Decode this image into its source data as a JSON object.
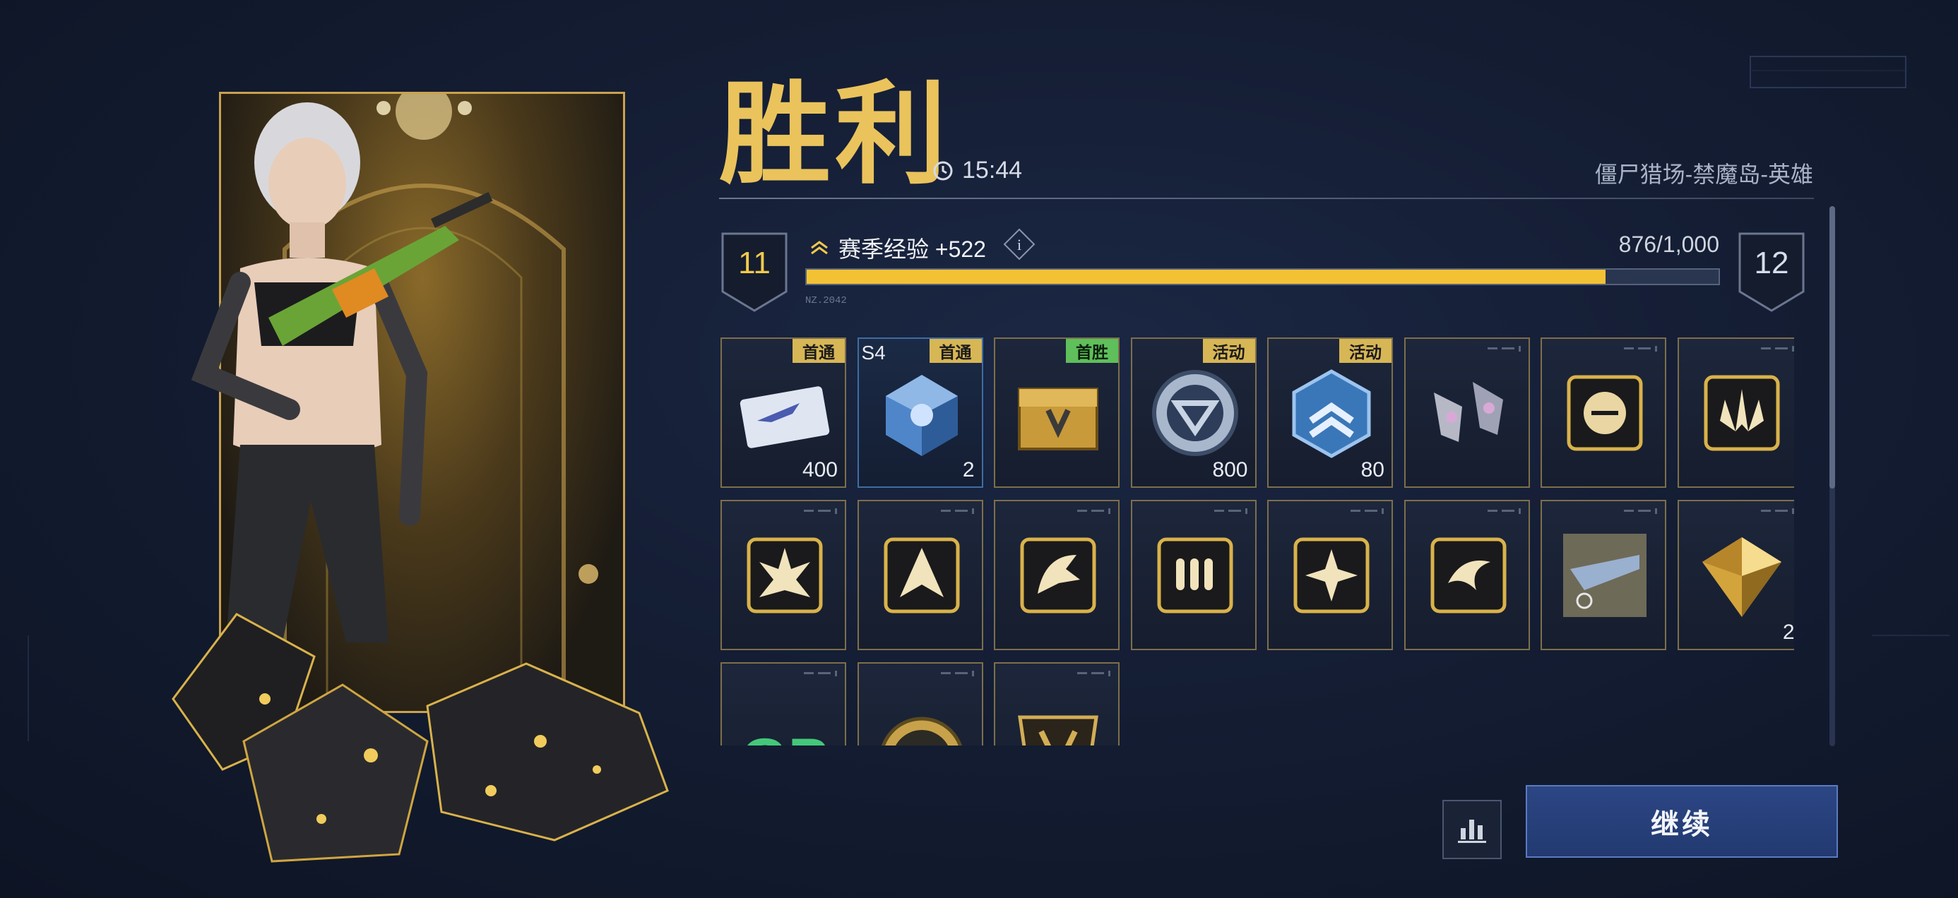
{
  "result": {
    "title": "胜利",
    "time": "15:44",
    "mode": "僵尸猎场-禁魔岛-英雄"
  },
  "xp": {
    "label": "赛季经验 +522",
    "current_level": "11",
    "next_level": "12",
    "progress_text": "876/1,000",
    "progress_fraction": 0.876,
    "bar_tag": "NZ.2042"
  },
  "rewards": [
    {
      "name": "ticket-card-icon",
      "tag": "首通",
      "tag_color": "gold",
      "quantity": "400",
      "style": "gold"
    },
    {
      "name": "s4-crystal-cube-icon",
      "tag": "首通",
      "tag_color": "gold",
      "quantity": "2",
      "season": "S4",
      "style": "blue"
    },
    {
      "name": "golden-chest-icon",
      "tag": "首胜",
      "tag_color": "green",
      "quantity": "",
      "style": "gold"
    },
    {
      "name": "silver-coin-icon",
      "tag": "活动",
      "tag_color": "gold",
      "quantity": "800",
      "style": "gold"
    },
    {
      "name": "rank-badge-icon",
      "tag": "活动",
      "tag_color": "gold",
      "quantity": "80",
      "style": "gold"
    },
    {
      "name": "gauntlets-icon",
      "tag": "",
      "tag_color": "",
      "quantity": "",
      "style": "gold"
    },
    {
      "name": "skill-chip-icon",
      "tag": "",
      "tag_color": "",
      "quantity": "",
      "style": "gold"
    },
    {
      "name": "skill-spikes-icon",
      "tag": "",
      "tag_color": "",
      "quantity": "",
      "style": "gold"
    },
    {
      "name": "skill-explosion-icon",
      "tag": "",
      "tag_color": "",
      "quantity": "",
      "style": "gold"
    },
    {
      "name": "skill-arrow-icon",
      "tag": "",
      "tag_color": "",
      "quantity": "",
      "style": "gold"
    },
    {
      "name": "skill-beast-icon",
      "tag": "",
      "tag_color": "",
      "quantity": "",
      "style": "gold"
    },
    {
      "name": "skill-ammo-icon",
      "tag": "",
      "tag_color": "",
      "quantity": "",
      "style": "gold"
    },
    {
      "name": "skill-star-burst-icon",
      "tag": "",
      "tag_color": "",
      "quantity": "",
      "style": "gold"
    },
    {
      "name": "skill-swirl-icon",
      "tag": "",
      "tag_color": "",
      "quantity": "",
      "style": "gold"
    },
    {
      "name": "weapon-blueprint-icon",
      "tag": "",
      "tag_color": "",
      "quantity": "",
      "style": "gold"
    },
    {
      "name": "gold-pyramid-icon",
      "tag": "",
      "tag_color": "",
      "quantity": "2",
      "style": "gold"
    },
    {
      "name": "green-gp-icon",
      "tag": "",
      "tag_color": "",
      "quantity": "",
      "style": "gold"
    },
    {
      "name": "gold-emblem-coin-icon",
      "tag": "",
      "tag_color": "",
      "quantity": "",
      "style": "gold"
    },
    {
      "name": "crest-frame-icon",
      "tag": "",
      "tag_color": "",
      "quantity": "",
      "style": "gold"
    }
  ],
  "buttons": {
    "continue": "继续"
  },
  "colors": {
    "accent_gold": "#eac35c",
    "xp_fill": "#f3c234",
    "button_blue": "#2c4685",
    "tag_gold": "#d7b656",
    "tag_green": "#5fbf5a"
  }
}
